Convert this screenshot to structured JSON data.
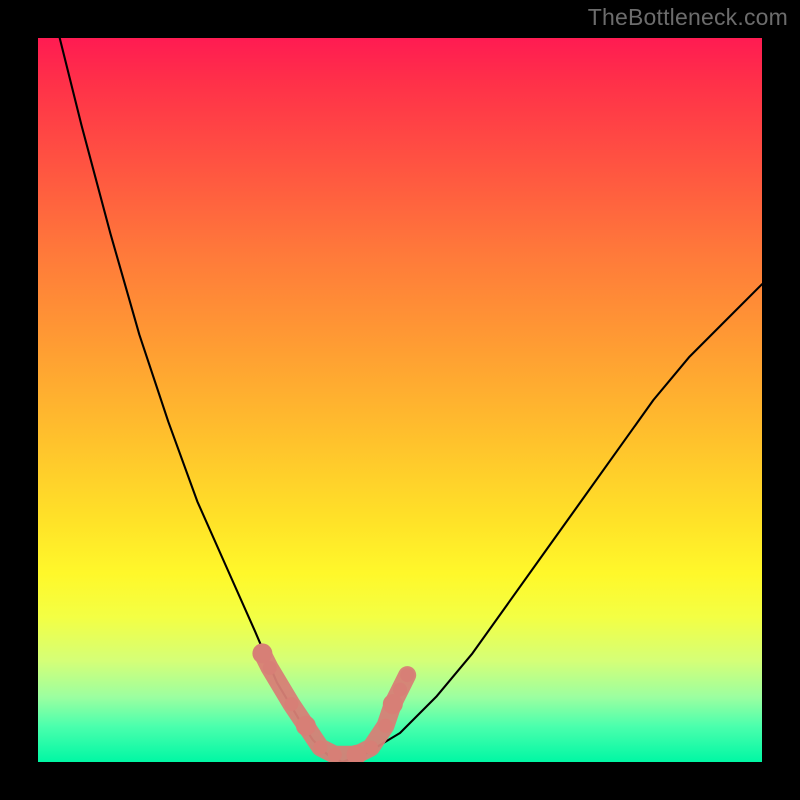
{
  "watermark": "TheBottleneck.com",
  "chart_data": {
    "type": "line",
    "title": "",
    "xlabel": "",
    "ylabel": "",
    "xlim": [
      0,
      1
    ],
    "ylim": [
      0,
      1
    ],
    "series": [
      {
        "name": "curve",
        "x": [
          0.03,
          0.06,
          0.1,
          0.14,
          0.18,
          0.22,
          0.26,
          0.3,
          0.33,
          0.36,
          0.38,
          0.4,
          0.42,
          0.45,
          0.5,
          0.55,
          0.6,
          0.65,
          0.7,
          0.75,
          0.8,
          0.85,
          0.9,
          0.95,
          1.0
        ],
        "values": [
          1.0,
          0.88,
          0.73,
          0.59,
          0.47,
          0.36,
          0.27,
          0.18,
          0.11,
          0.06,
          0.03,
          0.01,
          0.0,
          0.01,
          0.04,
          0.09,
          0.15,
          0.22,
          0.29,
          0.36,
          0.43,
          0.5,
          0.56,
          0.61,
          0.66
        ]
      }
    ],
    "markers": {
      "color": "#d77f76",
      "points_x": [
        0.31,
        0.32,
        0.35,
        0.37,
        0.39,
        0.41,
        0.44,
        0.46,
        0.48,
        0.49,
        0.5,
        0.51
      ],
      "points_y": [
        0.15,
        0.13,
        0.08,
        0.05,
        0.02,
        0.01,
        0.01,
        0.02,
        0.05,
        0.08,
        0.1,
        0.12
      ]
    }
  }
}
